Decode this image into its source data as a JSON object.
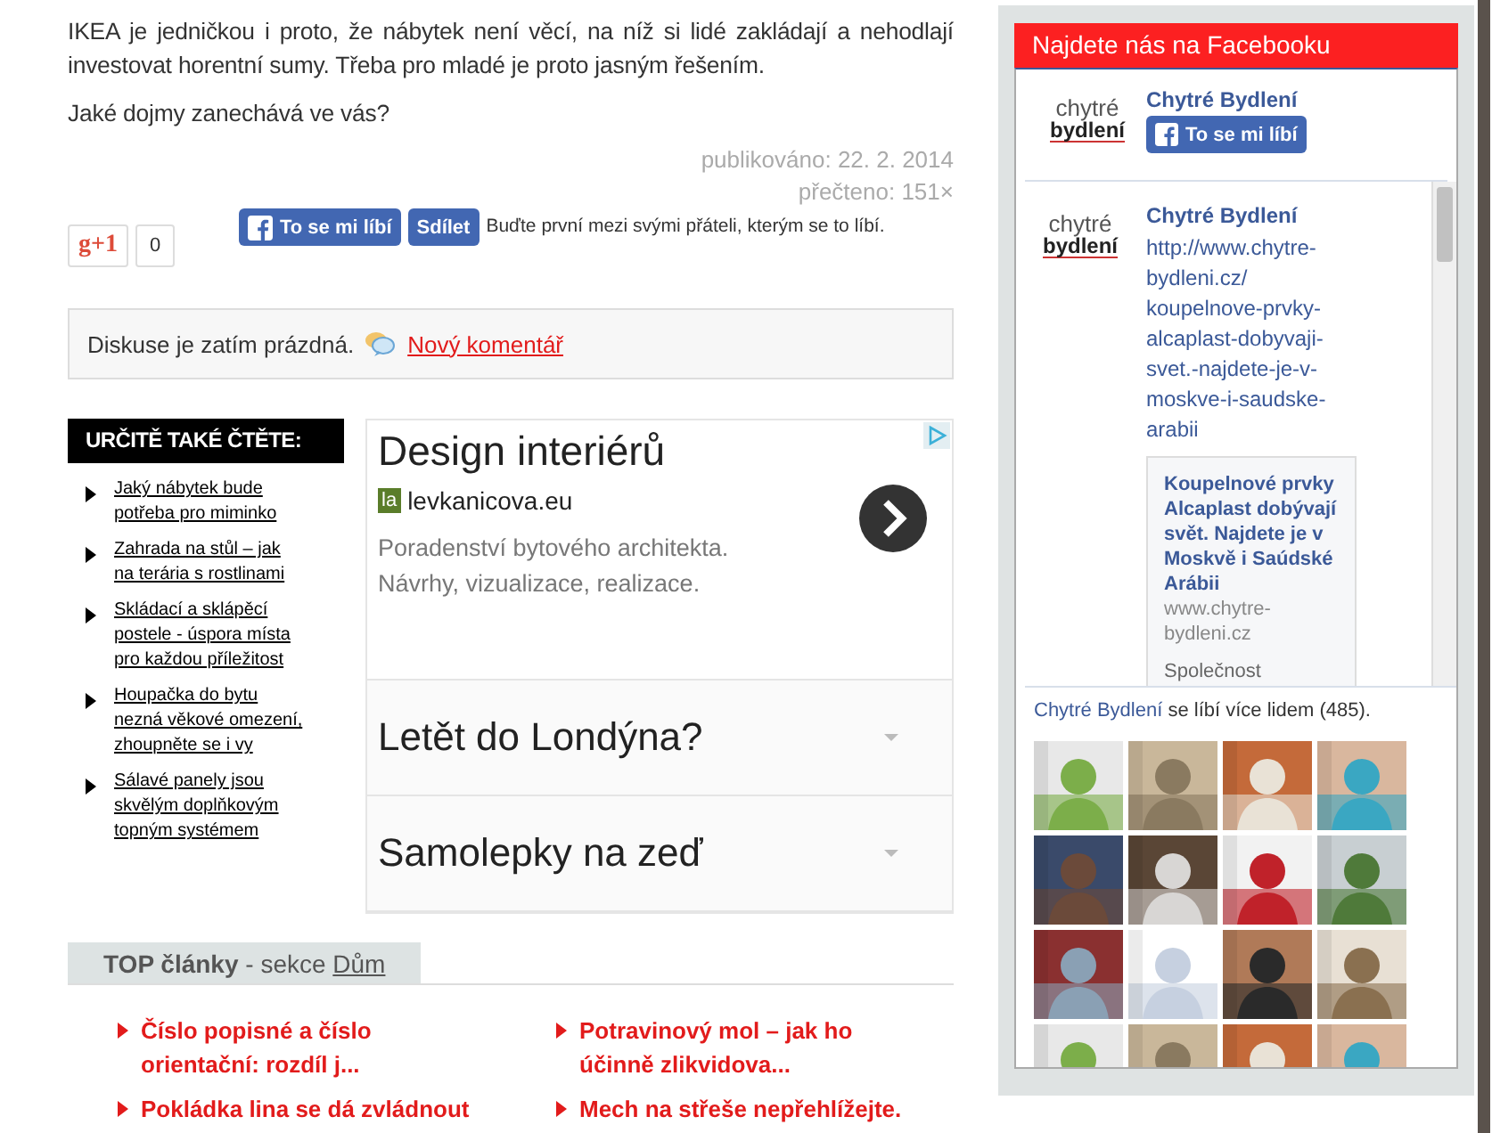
{
  "article": {
    "paragraphs": [
      "IKEA je jedničkou i proto, že nábytek není věcí, na níž si lidé zakládají a nehodlají investovat horentní sumy. Třeba pro mladé je proto jasným řešením.",
      "Jaké dojmy zanechává ve vás?"
    ],
    "published": "publikováno: 22. 2. 2014",
    "read_count": "přečteno: 151×"
  },
  "social": {
    "gplus_label": "g+1",
    "gplus_count": "0",
    "like_label": "To se mi líbí",
    "share_label": "Sdílet",
    "like_note": "Buďte první mezi svými přáteli, kterým se to líbí."
  },
  "discussion": {
    "text": "Diskuse je zatím prázdná.",
    "link": "Nový komentář"
  },
  "also_read": {
    "title": "URČITĚ TAKÉ ČTĚTE:",
    "items": [
      "Jaký nábytek bude potřeba pro miminko",
      "Zahrada na stůl – jak na terária s rostlinami",
      "Skládací a sklápěcí postele - úspora místa pro každou příležitost",
      "Houpačka do bytu nezná věkové omezení, zhoupněte se i vy",
      "Sálavé panely jsou skvělým doplňkovým topným systémem"
    ]
  },
  "ad": {
    "title": "Design interiérů",
    "domain_badge": "la",
    "domain": "levkanicova.eu",
    "description": "Poradenství bytového architekta. Návrhy, vizualizace, realizace.",
    "links": [
      "Letět do Londýna?",
      "Samolepky na zeď"
    ]
  },
  "top_articles": {
    "title": "TOP články",
    "section_prefix": "- sekce",
    "section": "Dům",
    "items": [
      "Číslo popisné a číslo orientační: rozdíl j...",
      "Potravinový mol – jak ho účinně zlikvidova...",
      "Pokládka lina se dá zvládnout",
      "Mech na střeše nepřehlížejte."
    ]
  },
  "facebook": {
    "header": "Najdete nás na Facebooku",
    "logo_top": "chytré",
    "logo_bottom": "bydlení",
    "page_name": "Chytré Bydlení",
    "like_label": "To se mi líbí",
    "post": {
      "logo_top": "chytré",
      "logo_bottom": "bydlení",
      "author": "Chytré Bydlení",
      "url": "http://www.chytre-bydleni.cz/ koupelnove-prvky-alcaplast-dobyvaji-svet.-najdete-je-v-moskve-i-saudske-arabii",
      "card_title": "Koupelnové prvky Alcaplast dobývají svět. Najdete je v Moskvě i Saúdské Arábii",
      "card_domain": "www.chytre-bydleni.cz",
      "card_extra": "Společnost"
    },
    "fans_link": "Chytré Bydlení",
    "fans_text": "se líbí více lidem (485)."
  }
}
